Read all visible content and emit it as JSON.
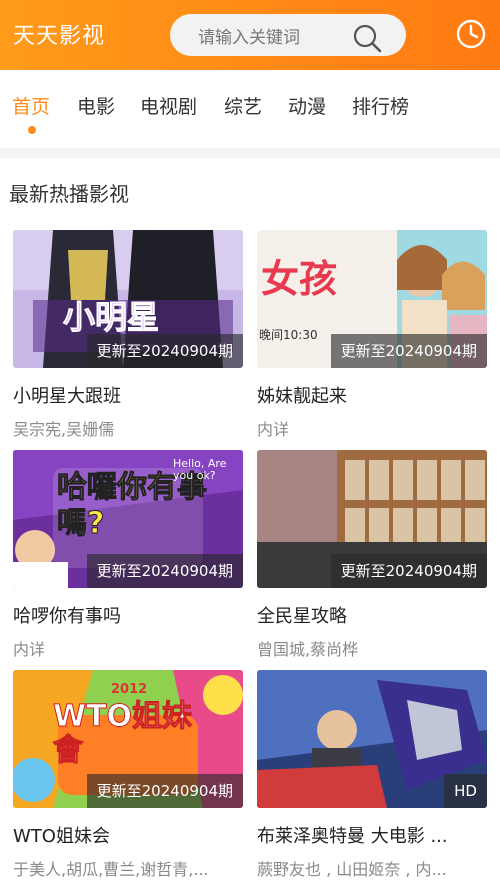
{
  "header": {
    "app_title": "天天影视",
    "search_placeholder": "请输入关键词",
    "search_icon": "search-icon",
    "history_icon": "clock-icon",
    "brand_color": "#ff8c1a"
  },
  "tabs": [
    {
      "label": "首页",
      "active": true
    },
    {
      "label": "电影",
      "active": false
    },
    {
      "label": "电视剧",
      "active": false
    },
    {
      "label": "综艺",
      "active": false
    },
    {
      "label": "动漫",
      "active": false
    },
    {
      "label": "排行榜",
      "active": false
    }
  ],
  "section": {
    "title": "最新热播影视"
  },
  "cards": [
    {
      "title": "小明星大跟班",
      "subtitle": "吴宗宪,吴姗儒",
      "badge": "更新至20240904期",
      "thumb_text": "小明星"
    },
    {
      "title": "姊妹靓起来",
      "subtitle": "内详",
      "badge": "更新至20240904期",
      "thumb_text": "女孩",
      "thumb_time": "晚间10:30"
    },
    {
      "title": "哈啰你有事吗",
      "subtitle": "内详",
      "badge": "更新至20240904期",
      "thumb_text": "哈囉你有事嗎?",
      "thumb_sub": "Hello, Are you ok?"
    },
    {
      "title": "全民星攻略",
      "subtitle": "曾国城,蔡尚桦",
      "badge": "更新至20240904期",
      "thumb_text": ""
    },
    {
      "title": "WTO姐妹会",
      "subtitle": "于美人,胡瓜,曹兰,谢哲青,...",
      "badge": "更新至20240904期",
      "thumb_text": "WTO姐妹會",
      "thumb_year": "2012"
    },
    {
      "title": "布莱泽奥特曼 大电影 ...",
      "subtitle": "蕨野友也 , 山田姬奈 , 内...",
      "badge": "HD",
      "thumb_text": ""
    }
  ]
}
